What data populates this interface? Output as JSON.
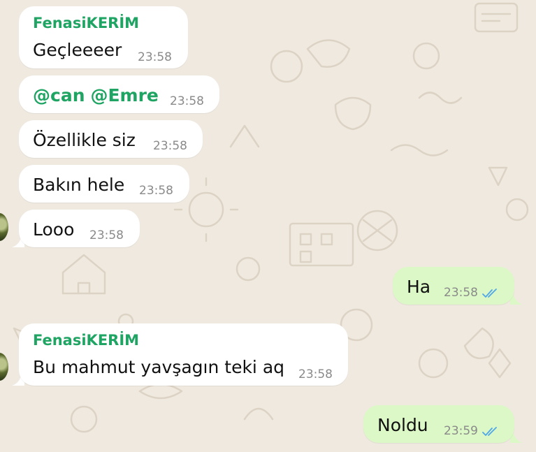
{
  "colors": {
    "background": "#efe9e0",
    "incoming_bubble": "#ffffff",
    "outgoing_bubble": "#dcf8c6",
    "sender_name": "#1fa463",
    "read_ticks": "#4fa6e8"
  },
  "messages": [
    {
      "sender": "FenasiKERİM",
      "text": "Geçleeeer",
      "time": "23:58"
    },
    {
      "mention_1": "@can",
      "mention_2": "@Emre",
      "time": "23:58"
    },
    {
      "text": "Özellikle siz",
      "time": "23:58"
    },
    {
      "text": "Bakın hele",
      "time": "23:58"
    },
    {
      "text": "Looo",
      "time": "23:58"
    },
    {
      "text": "Ha",
      "time": "23:58",
      "status_icon": "double-check-icon"
    },
    {
      "sender": "FenasiKERİM",
      "text": "Bu mahmut yavşagın teki aq",
      "time": "23:58"
    },
    {
      "text": "Noldu",
      "time": "23:59",
      "status_icon": "double-check-icon"
    }
  ]
}
